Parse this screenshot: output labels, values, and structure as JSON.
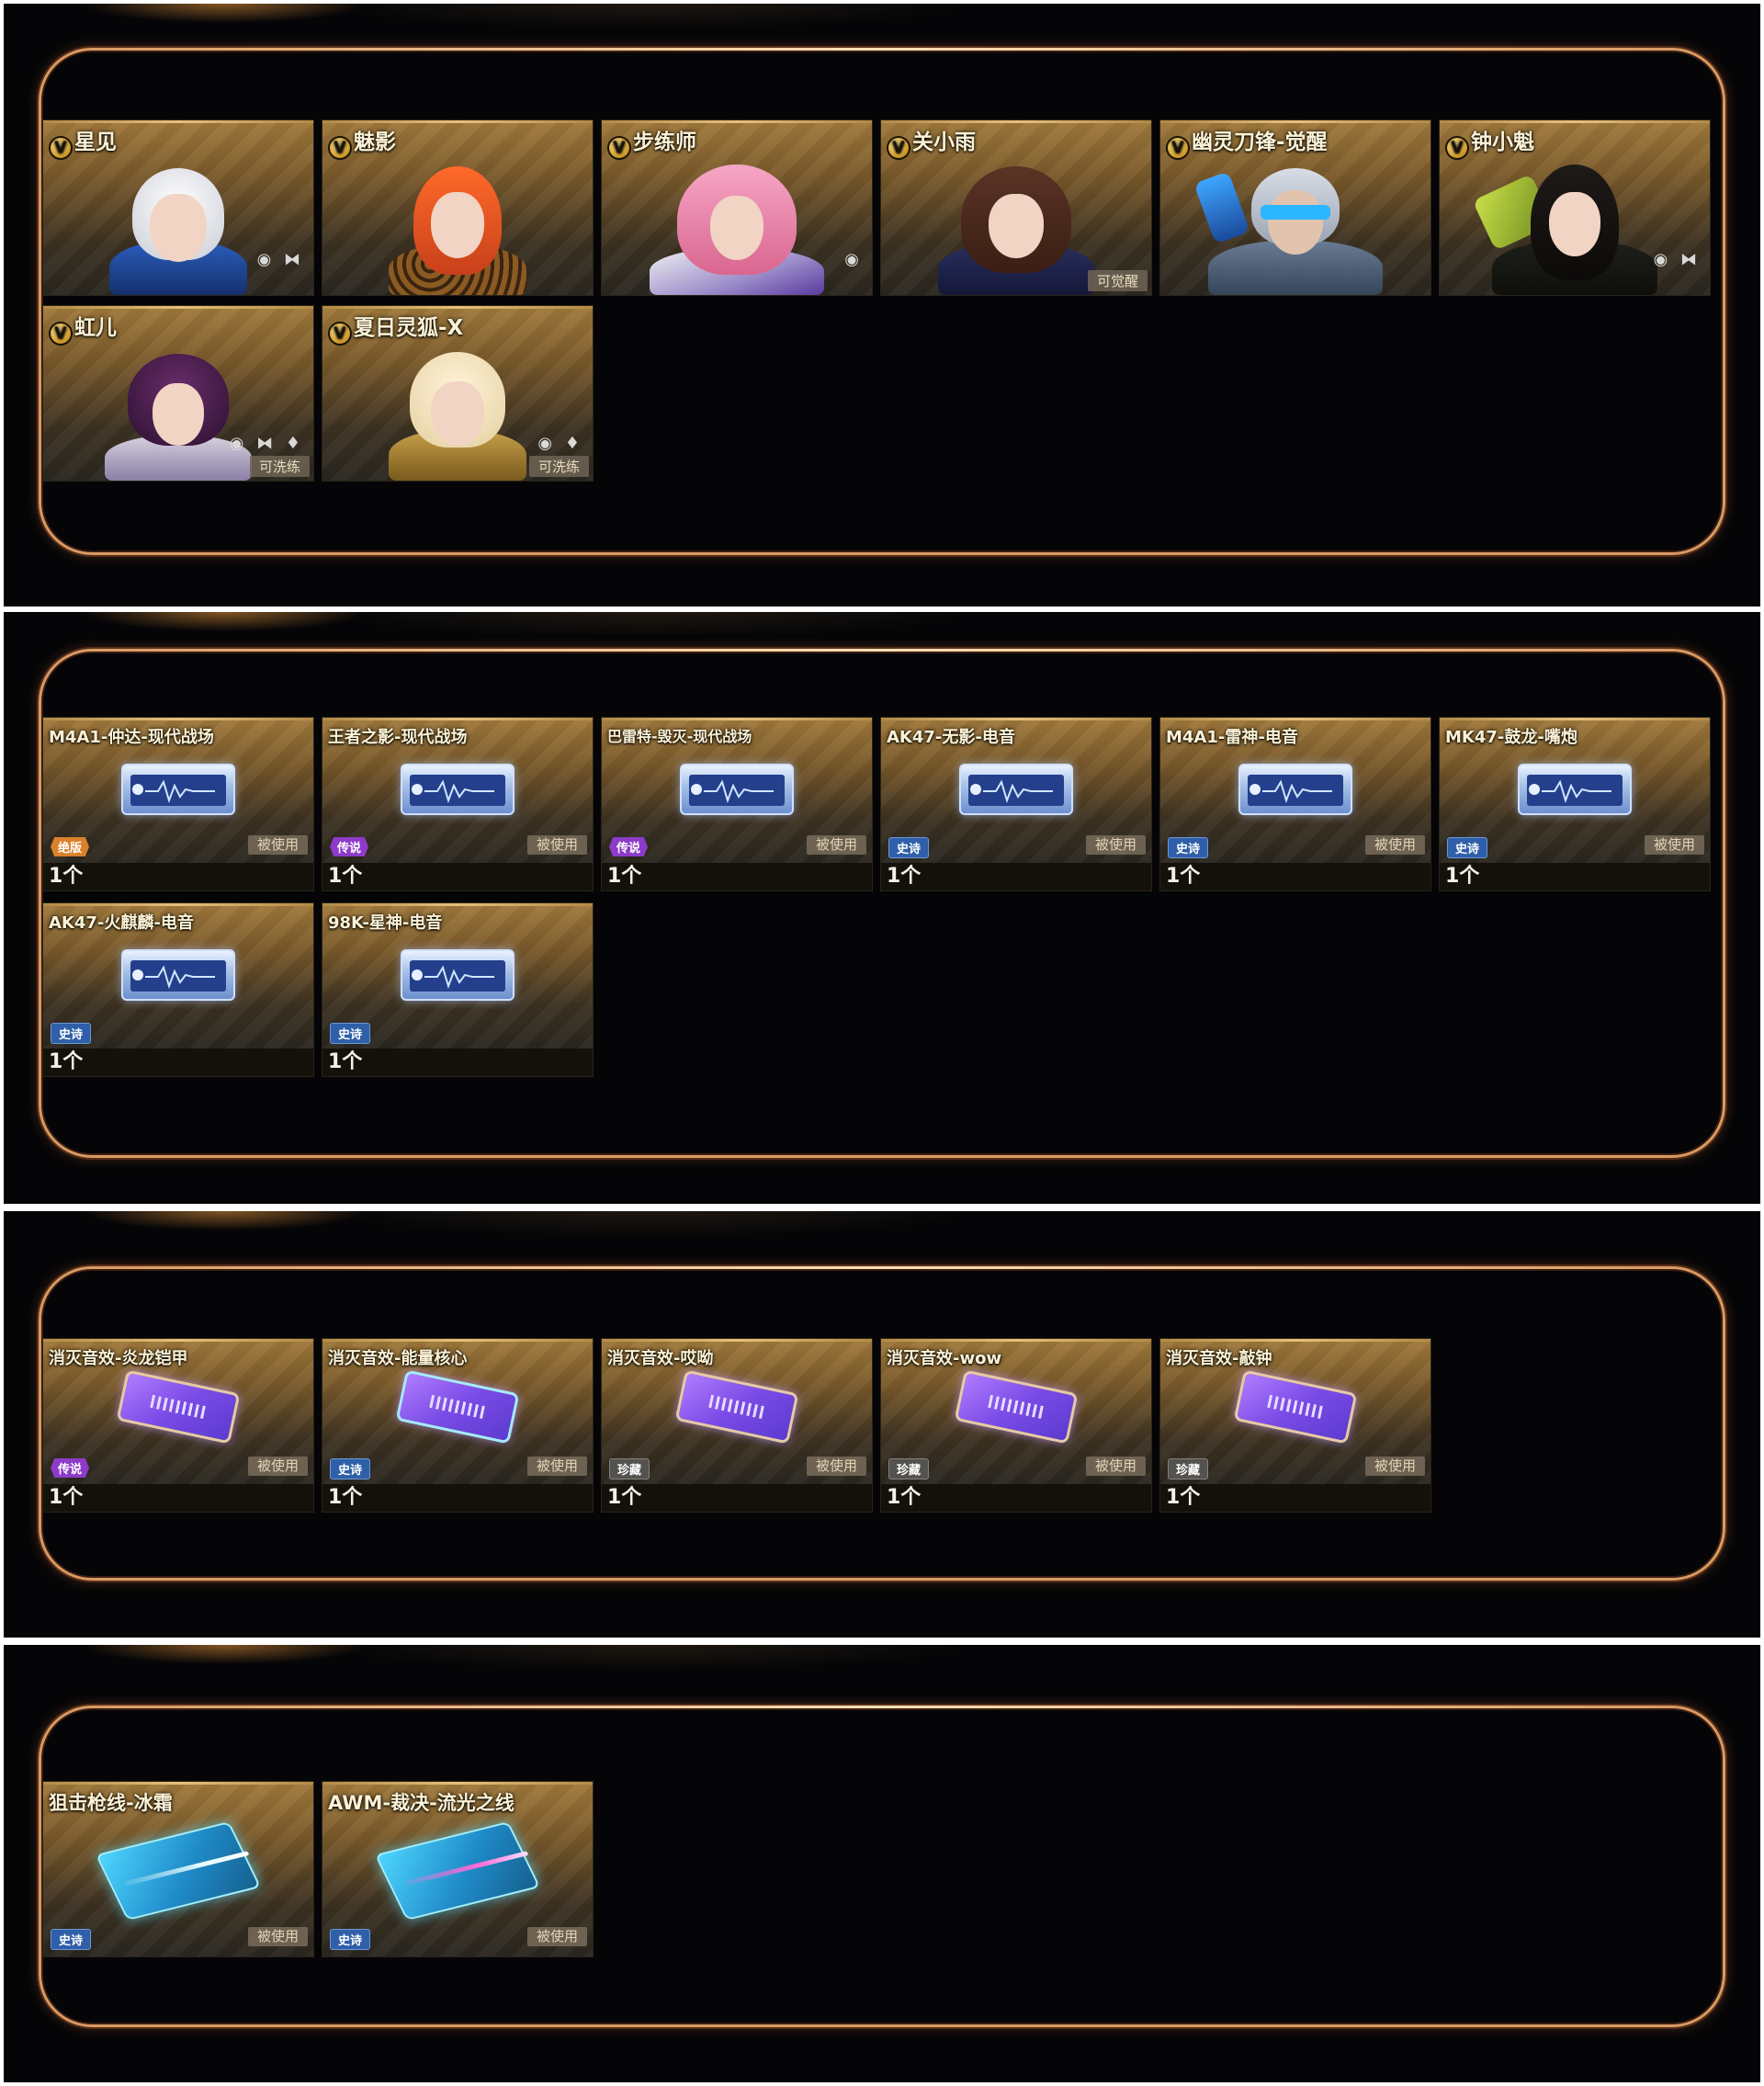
{
  "colors": {
    "frame": "#d89a63",
    "panel_bg": "#050507",
    "card_gold": "#a27b3d",
    "rarity_legend_orange": "#d9822b",
    "rarity_epic_purple": "#8d3bc9",
    "rarity_rare_blue": "#2f5fa8",
    "rarity_gray": "#53524e"
  },
  "characters": {
    "items": [
      {
        "name": "星见",
        "tag": ""
      },
      {
        "name": "魅影",
        "tag": ""
      },
      {
        "name": "步练师",
        "tag": ""
      },
      {
        "name": "关小雨",
        "tag": "可觉醒"
      },
      {
        "name": "幽灵刀锋-觉醒",
        "tag": ""
      },
      {
        "name": "钟小魁",
        "tag": ""
      },
      {
        "name": "虹儿",
        "tag": "可洗练"
      },
      {
        "name": "夏日灵狐-X",
        "tag": "可洗练"
      }
    ]
  },
  "weapon_sounds": {
    "items": [
      {
        "name": "M4A1-仲达-现代战场",
        "rarity": "绝版",
        "status": "被使用",
        "count": "1个"
      },
      {
        "name": "王者之影-现代战场",
        "rarity": "传说",
        "status": "被使用",
        "count": "1个"
      },
      {
        "name": "巴雷特-毁灭-现代战场",
        "rarity": "传说",
        "status": "被使用",
        "count": "1个"
      },
      {
        "name": "AK47-无影-电音",
        "rarity": "史诗",
        "status": "被使用",
        "count": "1个"
      },
      {
        "name": "M4A1-雷神-电音",
        "rarity": "史诗",
        "status": "被使用",
        "count": "1个"
      },
      {
        "name": "MK47-鼓龙-嘴炮",
        "rarity": "史诗",
        "status": "被使用",
        "count": "1个"
      },
      {
        "name": "AK47-火麒麟-电音",
        "rarity": "史诗",
        "status": "",
        "count": "1个"
      },
      {
        "name": "98K-星神-电音",
        "rarity": "史诗",
        "status": "",
        "count": "1个"
      }
    ]
  },
  "kill_sounds": {
    "items": [
      {
        "name": "消灭音效-炎龙铠甲",
        "rarity": "传说",
        "status": "被使用",
        "count": "1个"
      },
      {
        "name": "消灭音效-能量核心",
        "rarity": "史诗",
        "status": "被使用",
        "count": "1个"
      },
      {
        "name": "消灭音效-哎呦",
        "rarity": "珍藏",
        "status": "被使用",
        "count": "1个"
      },
      {
        "name": "消灭音效-wow",
        "rarity": "珍藏",
        "status": "被使用",
        "count": "1个"
      },
      {
        "name": "消灭音效-敲钟",
        "rarity": "珍藏",
        "status": "被使用",
        "count": "1个"
      }
    ]
  },
  "sniper_lines": {
    "items": [
      {
        "name": "狙击枪线-冰霜",
        "rarity": "史诗",
        "status": "被使用"
      },
      {
        "name": "AWM-裁决-流光之线",
        "rarity": "史诗",
        "status": "被使用"
      }
    ]
  }
}
